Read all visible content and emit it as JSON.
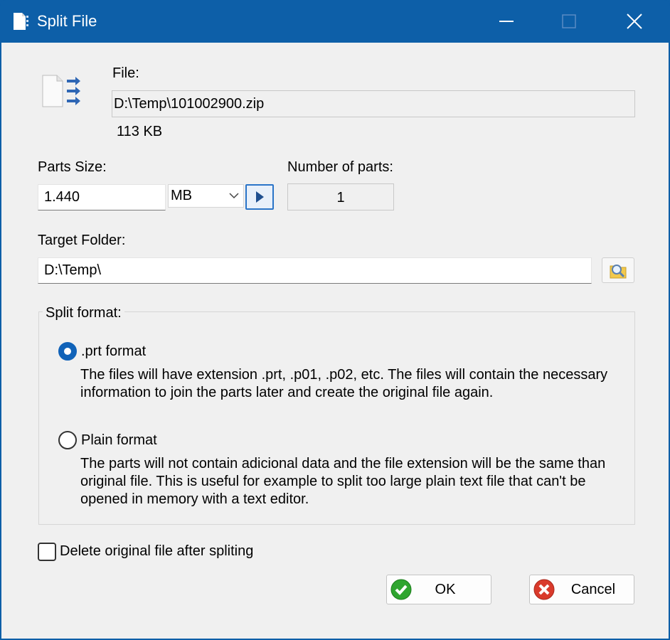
{
  "window": {
    "title": "Split File",
    "icon": "split-file-icon"
  },
  "file": {
    "label": "File:",
    "path": "D:\\Temp\\101002900.zip",
    "size": "113 KB",
    "icon": "file-split-arrows-icon"
  },
  "parts": {
    "size_label": "Parts Size:",
    "size_value": "1.440",
    "unit_selected": "MB",
    "apply_icon": "play-arrow-icon",
    "number_label": "Number of parts:",
    "number_value": "1"
  },
  "target": {
    "label": "Target Folder:",
    "path": "D:\\Temp\\",
    "browse_icon": "folder-search-icon"
  },
  "split_format": {
    "legend": "Split format:",
    "options": [
      {
        "label": ".prt format",
        "selected": true,
        "description": "The files will have extension .prt, .p01, .p02, etc. The files will contain the necessary information to join the parts later and create the original file again."
      },
      {
        "label": "Plain format",
        "selected": false,
        "description": "The parts will not contain adicional data and the file extension will be the same than original file. This is useful for example to split too large plain text file that can't be opened in memory with a text editor."
      }
    ]
  },
  "delete_original": {
    "label": "Delete original file after spliting",
    "checked": false
  },
  "buttons": {
    "ok": "OK",
    "cancel": "Cancel"
  },
  "colors": {
    "titlebar": "#0d5fa8",
    "accent": "#1062b8",
    "client_bg": "#f0f0f0",
    "ok_green": "#2fa52f",
    "cancel_red": "#d93a2b"
  }
}
